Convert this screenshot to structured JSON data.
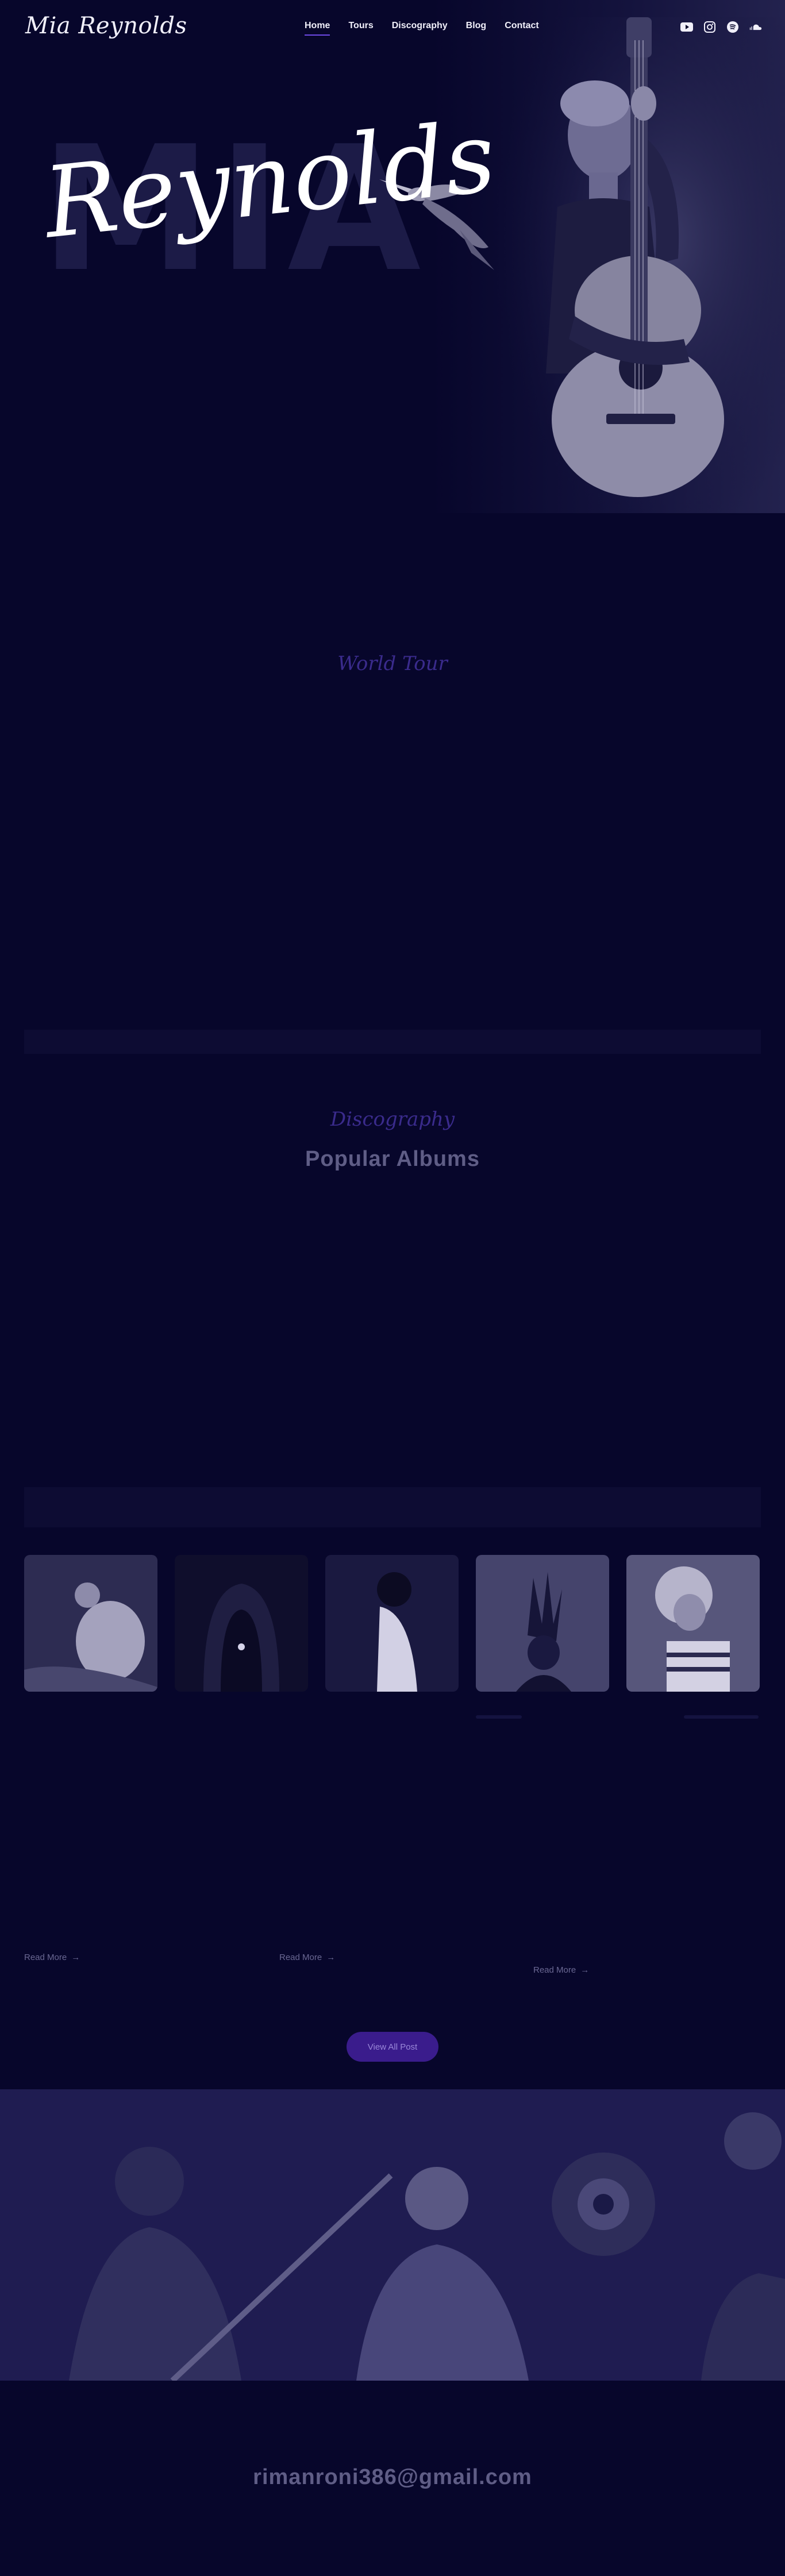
{
  "header": {
    "logo": "Mia Reynolds",
    "nav": [
      {
        "label": "Home",
        "active": true
      },
      {
        "label": "Tours"
      },
      {
        "label": "Discography"
      },
      {
        "label": "Blog"
      },
      {
        "label": "Contact"
      }
    ],
    "social_icons": [
      "youtube-icon",
      "instagram-icon",
      "spotify-icon",
      "soundcloud-icon"
    ]
  },
  "hero": {
    "background_word": "MIA",
    "script_name": "Reynolds"
  },
  "tour": {
    "subtitle": "World Tour"
  },
  "discography": {
    "subtitle": "Discography",
    "title": "Popular Albums"
  },
  "blog": {
    "read_more": [
      "Read More",
      "Read More",
      "Read More"
    ],
    "view_all": "View All Post"
  },
  "footer": {
    "email": "rimanroni386@gmail.com"
  },
  "colors": {
    "background": "#07062b",
    "accent": "#6d49e6",
    "button": "#3a1c8c",
    "muted_text": "#5f5d86"
  }
}
